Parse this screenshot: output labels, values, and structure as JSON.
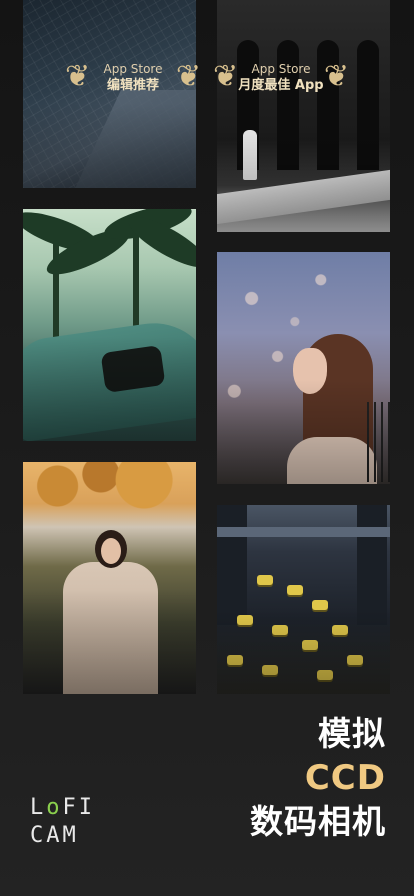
{
  "badges": [
    {
      "line1": "App Store",
      "line2": "编辑推荐"
    },
    {
      "line1": "App Store",
      "line2": "月度最佳 App"
    }
  ],
  "tagline": {
    "line1": "模拟",
    "line2": "CCD",
    "line3": "数码相机"
  },
  "logo": {
    "row1_a": "L",
    "row1_o": "o",
    "row1_b": "FI",
    "row2": "CAM"
  },
  "colors": {
    "accent_gold": "#f0c982",
    "logo_green": "#8bd04e",
    "background": "#1c1c1c"
  },
  "icons": [
    "laurel-left-icon",
    "laurel-right-icon"
  ]
}
